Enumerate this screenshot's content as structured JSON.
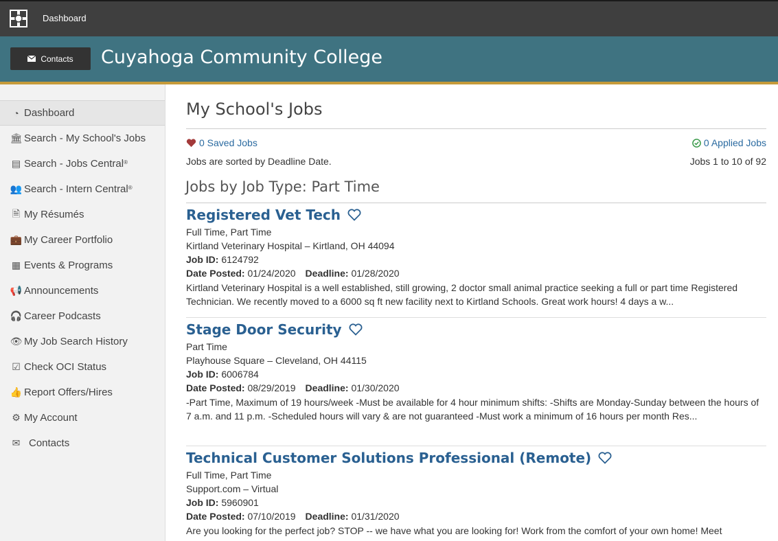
{
  "topbar": {
    "dashboard_label": "Dashboard"
  },
  "header": {
    "contacts_label": "Contacts",
    "college_name": "Cuyahoga Community College"
  },
  "sidebar": {
    "items": [
      {
        "label": "Dashboard",
        "icon": "dashboard-icon"
      },
      {
        "label": "Search - My School's Jobs",
        "icon": "institution-icon"
      },
      {
        "label": "Search - Jobs Central",
        "sup": "®",
        "icon": "flag-icon"
      },
      {
        "label": "Search - Intern Central",
        "sup": "®",
        "icon": "users-icon"
      },
      {
        "label": "My Résumés",
        "icon": "file-icon"
      },
      {
        "label": "My Career Portfolio",
        "icon": "briefcase-icon"
      },
      {
        "label": "Events & Programs",
        "icon": "calendar-icon"
      },
      {
        "label": "Announcements",
        "icon": "bullhorn-icon"
      },
      {
        "label": "Career Podcasts",
        "icon": "headphones-icon"
      },
      {
        "label": "My Job Search History",
        "icon": "eye-icon"
      },
      {
        "label": "Check OCI Status",
        "icon": "check-square-icon"
      },
      {
        "label": "Report Offers/Hires",
        "icon": "thumbs-up-icon"
      },
      {
        "label": "My Account",
        "icon": "account-icon"
      },
      {
        "label": "Contacts",
        "icon": "envelope-icon"
      }
    ]
  },
  "main": {
    "title": "My School's Jobs",
    "saved_jobs": "0 Saved Jobs",
    "applied_jobs": "0 Applied Jobs",
    "sorted_text": "Jobs are sorted by Deadline Date.",
    "count_text": "Jobs 1 to 10 of 92",
    "job_type_heading": "Jobs by Job Type: Part Time",
    "labels": {
      "job_id": "Job ID:",
      "date_posted": "Date Posted:",
      "deadline": "Deadline:"
    },
    "jobs": [
      {
        "title": "Registered Vet Tech",
        "type": "Full Time, Part Time",
        "location": "Kirtland Veterinary Hospital – Kirtland, OH 44094",
        "job_id": "6124792",
        "date_posted": "01/24/2020",
        "deadline": "01/28/2020",
        "desc": "Kirtland Veterinary Hospital is a well established, still growing, 2 doctor small animal practice seeking a full or part time Registered Technician. We recently moved to a 6000 sq ft new facility next to Kirtland Schools. Great work hours! 4 days a w..."
      },
      {
        "title": "Stage Door Security",
        "type": "Part Time",
        "location": "Playhouse Square – Cleveland, OH 44115",
        "job_id": "6006784",
        "date_posted": "08/29/2019",
        "deadline": "01/30/2020",
        "desc": "-Part Time, Maximum of 19 hours/week -Must be available for 4 hour minimum shifts: -Shifts are Monday-Sunday between the hours of 7 a.m. and 11 p.m. -Scheduled hours will vary & are not guaranteed -Must work a minimum of 16 hours per month Res..."
      },
      {
        "title": "Technical Customer Solutions Professional (Remote)",
        "type": "Full Time, Part Time",
        "location": "Support.com – Virtual",
        "job_id": "5960901",
        "date_posted": "07/10/2019",
        "deadline": "01/31/2020",
        "desc": "Are you looking for the perfect job? STOP -- we have what you are looking for! Work from the comfort of your own home! Meet"
      }
    ]
  },
  "colors": {
    "topbar": "#3f3f3f",
    "header": "#3f7381",
    "accent": "#c59a3a",
    "link": "#2a6091"
  }
}
